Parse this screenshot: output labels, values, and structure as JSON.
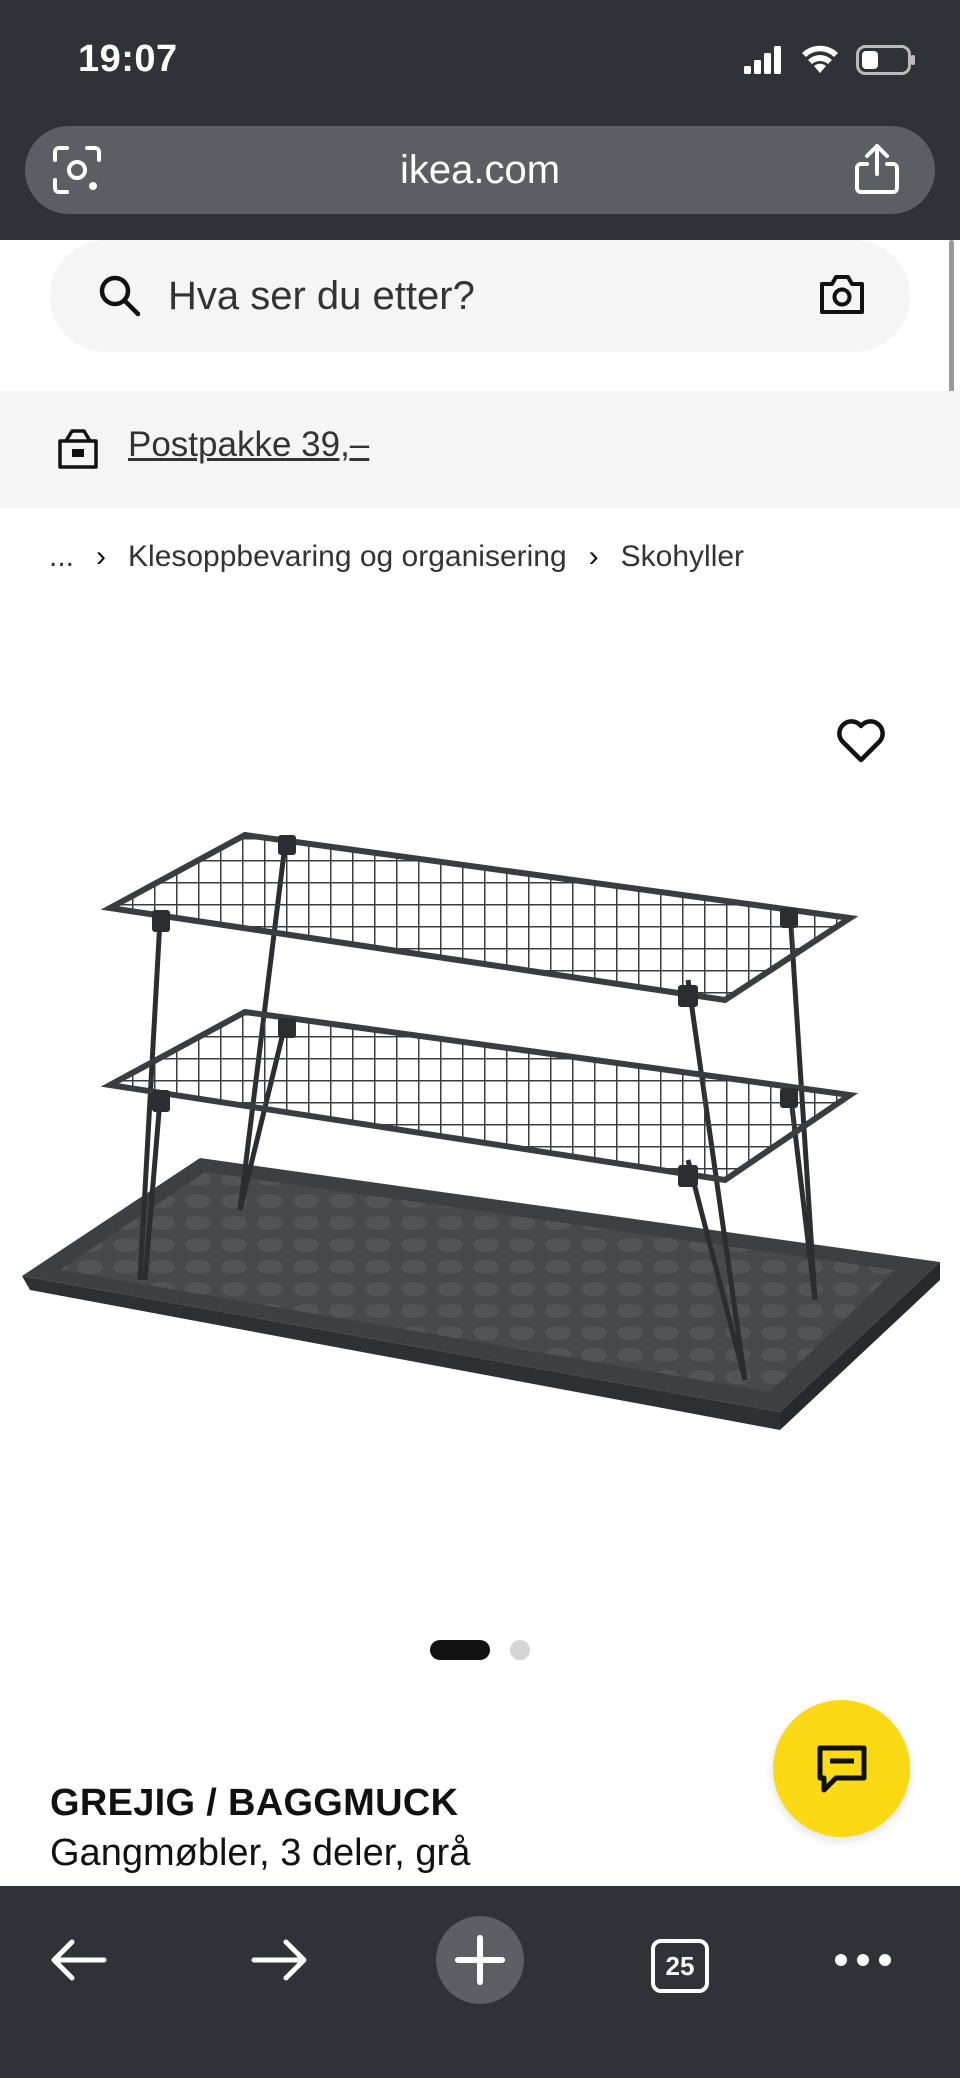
{
  "status_bar": {
    "time": "19:07"
  },
  "browser": {
    "url": "ikea.com",
    "left_icon": "lens-camera-icon",
    "right_icon": "share-icon"
  },
  "search": {
    "placeholder": "Hva ser du etter?",
    "icon": "search-icon",
    "camera_icon": "camera-icon"
  },
  "promo": {
    "text": "Postpakke 39,–",
    "icon": "package-icon"
  },
  "breadcrumb": {
    "items": [
      "...",
      "Klesoppbevaring og organisering",
      "Skohyller"
    ]
  },
  "product": {
    "name": "GREJIG / BAGGMUCK",
    "description": "Gangmøbler, 3 deler, grå",
    "image_slides": 2,
    "active_slide": 1
  },
  "toolbar": {
    "tab_count": "25"
  },
  "colors": {
    "chrome": "#2f3236",
    "url_bar": "#5b5f64",
    "fab": "#fbd914",
    "banner": "#f5f5f5"
  }
}
